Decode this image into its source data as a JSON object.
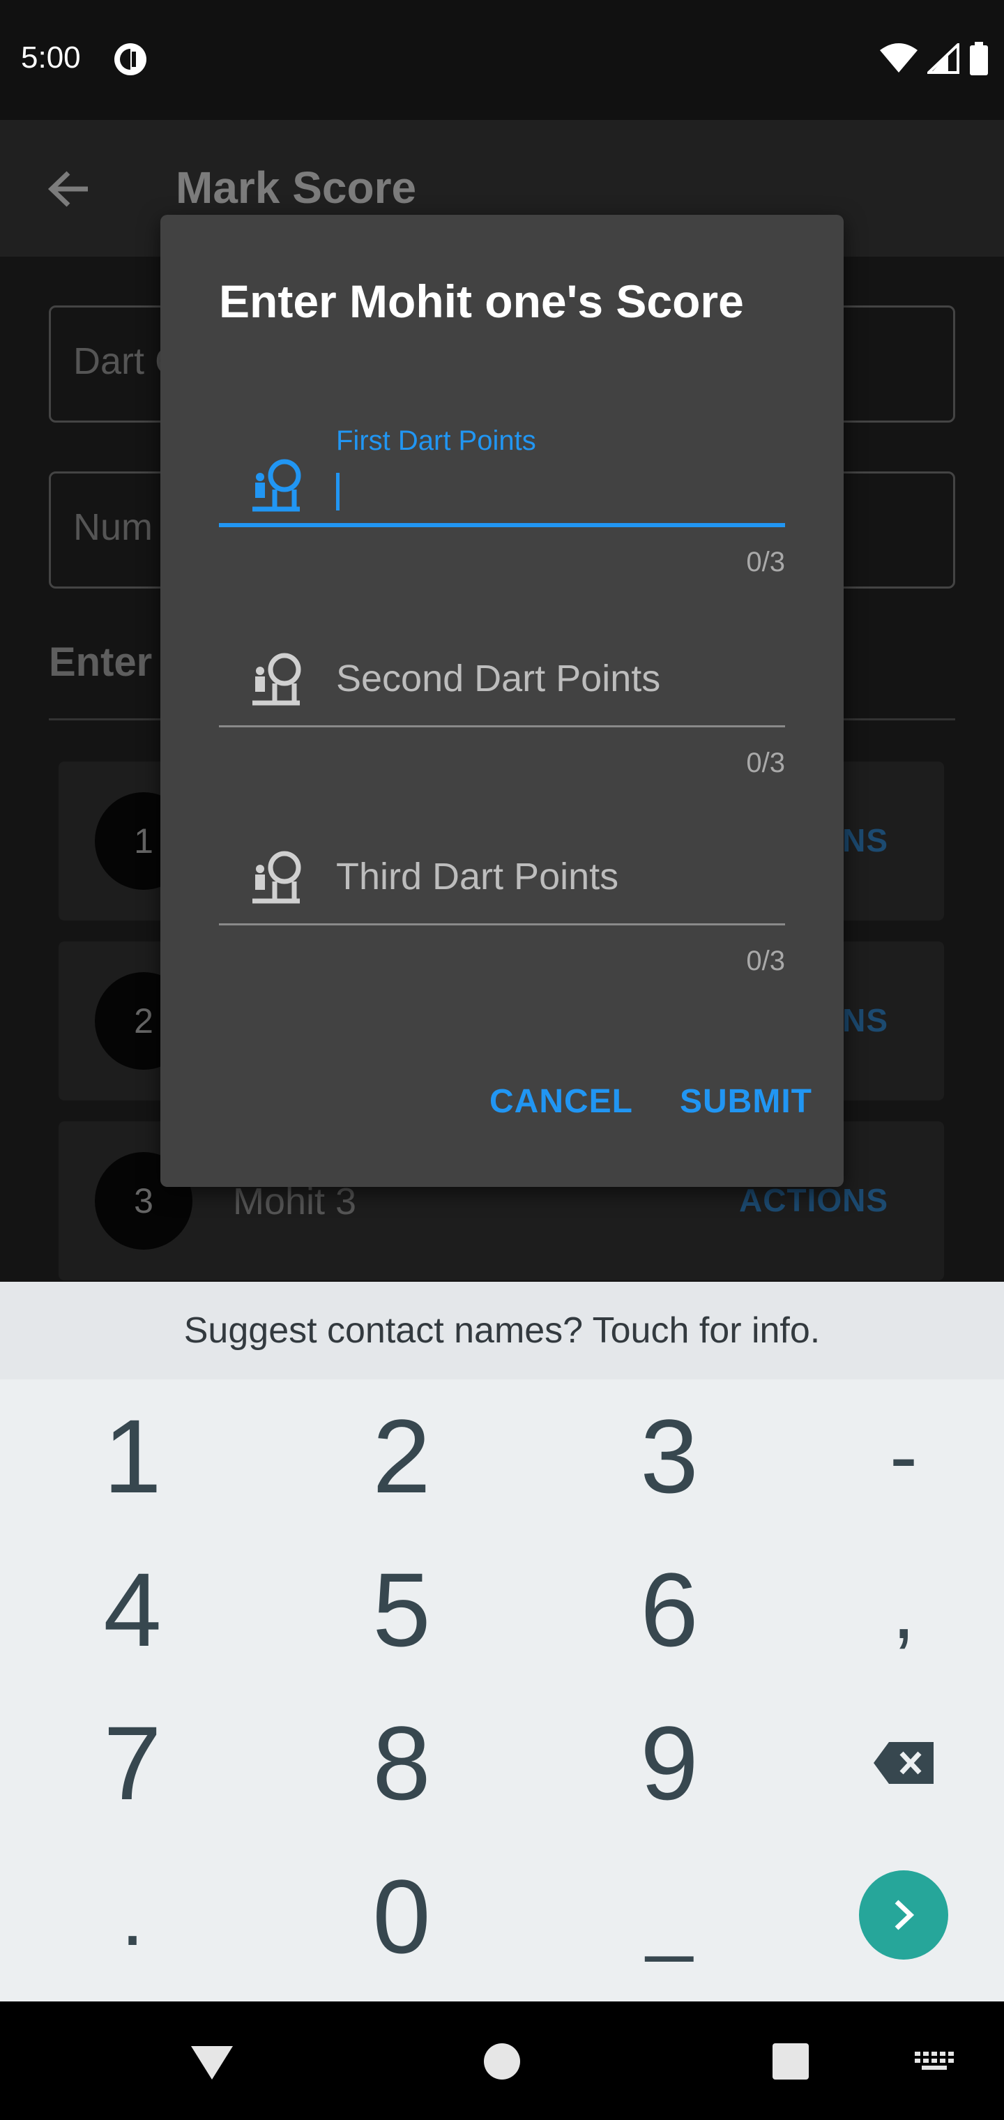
{
  "status_bar": {
    "time": "5:00",
    "icons": [
      "app-notification-icon",
      "wifi-icon",
      "signal-icon",
      "battery-icon"
    ]
  },
  "app_bar": {
    "title": "Mark Score",
    "back_icon": "arrow-back-icon"
  },
  "background": {
    "field1_placeholder": "Dart C",
    "field2_placeholder": "Num",
    "section_label": "Enter",
    "players": [
      {
        "number": "1",
        "name": "",
        "action": "ONS"
      },
      {
        "number": "2",
        "name": "",
        "action": "ONS"
      },
      {
        "number": "3",
        "name": "Mohit 3",
        "action": "ACTIONS"
      }
    ]
  },
  "dialog": {
    "title": "Enter Mohit one's Score",
    "fields": [
      {
        "label": "First Dart Points",
        "value": "",
        "counter": "0/3",
        "focused": true,
        "icon": "dart-player-icon"
      },
      {
        "label": "Second Dart Points",
        "value": "",
        "counter": "0/3",
        "focused": false,
        "icon": "dart-player-icon"
      },
      {
        "label": "Third Dart Points",
        "value": "",
        "counter": "0/3",
        "focused": false,
        "icon": "dart-player-icon"
      }
    ],
    "cancel_label": "CANCEL",
    "submit_label": "SUBMIT"
  },
  "keyboard": {
    "suggestion": "Suggest contact names? Touch for info.",
    "rows": [
      [
        "1",
        "2",
        "3",
        "-"
      ],
      [
        "4",
        "5",
        "6",
        ","
      ],
      [
        "7",
        "8",
        "9",
        "backspace-icon"
      ],
      [
        ".",
        "0",
        "_",
        "enter-icon"
      ]
    ]
  },
  "colors": {
    "accent": "#2196f3",
    "dialog_bg": "#424242",
    "keyboard_bg": "#eceff1",
    "enter_key": "#26a69a"
  },
  "nav_bar": {
    "icons": [
      "back-triangle-icon",
      "home-circle-icon",
      "recents-square-icon",
      "keyboard-icon"
    ]
  }
}
